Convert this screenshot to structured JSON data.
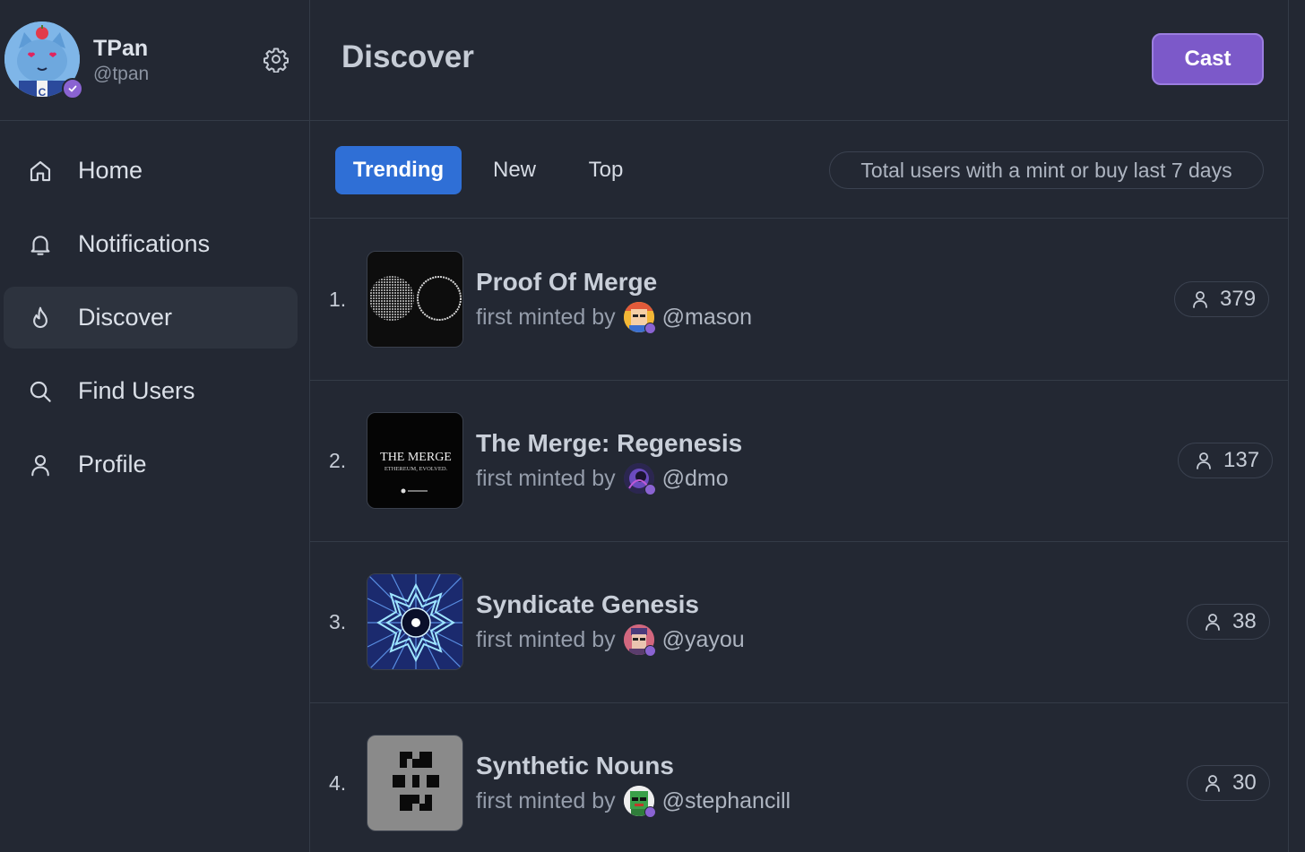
{
  "user": {
    "name": "TPan",
    "handle": "@tpan"
  },
  "nav": {
    "items": [
      {
        "label": "Home",
        "icon": "home-icon"
      },
      {
        "label": "Notifications",
        "icon": "bell-icon"
      },
      {
        "label": "Discover",
        "icon": "flame-icon",
        "active": true
      },
      {
        "label": "Find Users",
        "icon": "search-icon"
      },
      {
        "label": "Profile",
        "icon": "user-icon"
      }
    ]
  },
  "header": {
    "title": "Discover",
    "cast_label": "Cast"
  },
  "tabs": {
    "items": [
      {
        "label": "Trending",
        "active": true
      },
      {
        "label": "New"
      },
      {
        "label": "Top"
      }
    ],
    "filter_label": "Total users with a mint or buy last 7 days"
  },
  "list": {
    "minted_prefix": "first minted by",
    "items": [
      {
        "rank": "1.",
        "title": "Proof Of Merge",
        "user": "@mason",
        "count": "379"
      },
      {
        "rank": "2.",
        "title": "The Merge: Regenesis",
        "user": "@dmo",
        "count": "137"
      },
      {
        "rank": "3.",
        "title": "Syndicate Genesis",
        "user": "@yayou",
        "count": "38"
      },
      {
        "rank": "4.",
        "title": "Synthetic Nouns",
        "user": "@stephancill",
        "count": "30"
      }
    ],
    "thumb2_text": {
      "line1": "THE MERGE",
      "line2": "ETHEREUM, EVOLVED."
    }
  },
  "colors": {
    "background": "#232833",
    "accent_purple": "#7c59c9",
    "tab_active_blue": "#2f6fd6",
    "verified_badge": "#8a63d2"
  }
}
